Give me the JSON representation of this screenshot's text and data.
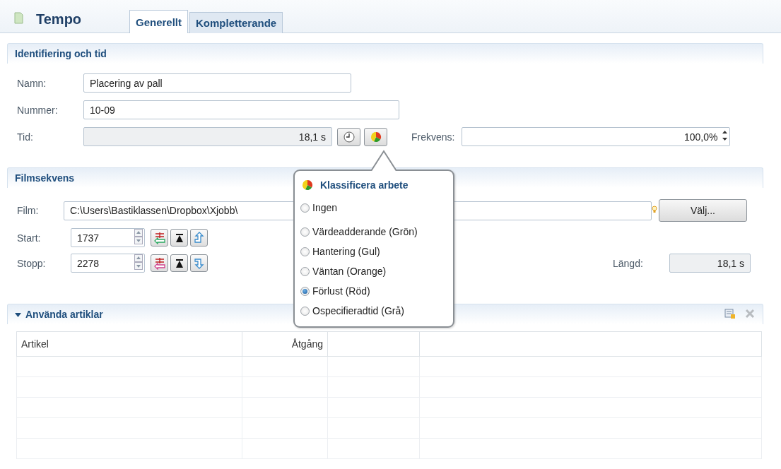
{
  "header": {
    "title": "Tempo"
  },
  "tabs": [
    {
      "label": "Generellt",
      "selected": true
    },
    {
      "label": "Kompletterande",
      "selected": false
    }
  ],
  "identification": {
    "title": "Identifiering och tid",
    "name_label": "Namn:",
    "name_value": "Placering av pall",
    "number_label": "Nummer:",
    "number_value": "10-09",
    "time_label": "Tid:",
    "time_value": "18,1 s",
    "frequency_label": "Frekvens:",
    "frequency_value": "100,0%"
  },
  "film_sequence": {
    "title": "Filmsekvens",
    "film_label": "Film:",
    "film_value": "C:\\Users\\Bastiklassen\\Dropbox\\Xjobb\\",
    "choose_button": "Välj...",
    "start_label": "Start:",
    "start_value": "1737",
    "stop_label": "Stopp:",
    "stop_value": "2278",
    "length_label": "Längd:",
    "length_value": "18,1 s"
  },
  "articles": {
    "title": "Använda artiklar",
    "expanded": true,
    "columns": [
      "Artikel",
      "Åtgång"
    ]
  },
  "classify_popup": {
    "title": "Klassificera arbete",
    "options": [
      {
        "label": "Ingen",
        "selected": false
      },
      {
        "label": "Värdeadderande (Grön)",
        "selected": false
      },
      {
        "label": "Hantering (Gul)",
        "selected": false
      },
      {
        "label": "Väntan (Orange)",
        "selected": false
      },
      {
        "label": "Förlust (Röd)",
        "selected": true
      },
      {
        "label": "Ospecifieradtid (Grå)",
        "selected": false
      }
    ]
  }
}
